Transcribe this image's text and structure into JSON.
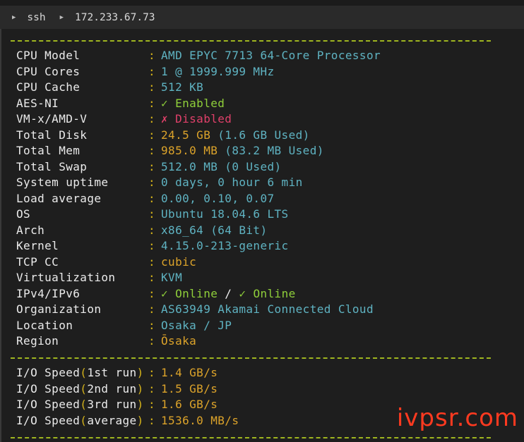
{
  "tab": {
    "breadcrumb": [
      "ssh",
      "172.233.67.73"
    ]
  },
  "system_info": [
    {
      "label": "CPU Model",
      "value": [
        {
          "t": "AMD EPYC 7713 64-Core Processor",
          "c": "cyan"
        }
      ]
    },
    {
      "label": "CPU Cores",
      "value": [
        {
          "t": "1 @ 1999.999 MHz",
          "c": "cyan"
        }
      ]
    },
    {
      "label": "CPU Cache",
      "value": [
        {
          "t": "512 KB",
          "c": "cyan"
        }
      ]
    },
    {
      "label": "AES-NI",
      "value": [
        {
          "t": "✓ Enabled",
          "c": "green"
        }
      ]
    },
    {
      "label": "VM-x/AMD-V",
      "value": [
        {
          "t": "✗ ",
          "c": "red"
        },
        {
          "t": "Disabled",
          "c": "red"
        }
      ]
    },
    {
      "label": "Total Disk",
      "value": [
        {
          "t": "24.5 GB",
          "c": "yellow"
        },
        {
          "t": " (1.6 GB Used)",
          "c": "cyan"
        }
      ]
    },
    {
      "label": "Total Mem",
      "value": [
        {
          "t": "985.0 MB",
          "c": "yellow"
        },
        {
          "t": " (83.2 MB Used)",
          "c": "cyan"
        }
      ]
    },
    {
      "label": "Total Swap",
      "value": [
        {
          "t": "512.0 MB (0 Used)",
          "c": "cyan"
        }
      ]
    },
    {
      "label": "System uptime",
      "value": [
        {
          "t": "0 days, 0 hour 6 min",
          "c": "cyan"
        }
      ]
    },
    {
      "label": "Load average",
      "value": [
        {
          "t": "0.00, 0.10, 0.07",
          "c": "cyan"
        }
      ]
    },
    {
      "label": "OS",
      "value": [
        {
          "t": "Ubuntu 18.04.6 LTS",
          "c": "cyan"
        }
      ]
    },
    {
      "label": "Arch",
      "value": [
        {
          "t": "x86_64 (64 Bit)",
          "c": "cyan"
        }
      ]
    },
    {
      "label": "Kernel",
      "value": [
        {
          "t": "4.15.0-213-generic",
          "c": "cyan"
        }
      ]
    },
    {
      "label": "TCP CC",
      "value": [
        {
          "t": "cubic",
          "c": "yellow"
        }
      ]
    },
    {
      "label": "Virtualization",
      "value": [
        {
          "t": "KVM",
          "c": "cyan"
        }
      ]
    },
    {
      "label": "IPv4/IPv6",
      "value": [
        {
          "t": "✓ Online",
          "c": "green"
        },
        {
          "t": " / ",
          "c": "white"
        },
        {
          "t": "✓ Online",
          "c": "green"
        }
      ]
    },
    {
      "label": "Organization",
      "value": [
        {
          "t": "AS63949 Akamai Connected Cloud",
          "c": "cyan"
        }
      ]
    },
    {
      "label": "Location",
      "value": [
        {
          "t": "Osaka / JP",
          "c": "cyan"
        }
      ]
    },
    {
      "label": "Region",
      "value": [
        {
          "t": "Ōsaka",
          "c": "yellow"
        }
      ]
    }
  ],
  "io_speed": [
    {
      "prefix": "I/O Speed",
      "run": "1st run",
      "value": "1.4 GB/s"
    },
    {
      "prefix": "I/O Speed",
      "run": "2nd run",
      "value": "1.5 GB/s"
    },
    {
      "prefix": "I/O Speed",
      "run": "3rd run",
      "value": "1.6 GB/s"
    },
    {
      "prefix": "I/O Speed",
      "run": "average",
      "value": "1536.0 MB/s"
    }
  ],
  "separator": ":",
  "watermark": "ivpsr.com",
  "colors": {
    "background": "#1e1e1e",
    "cyan": "#5fb3c2",
    "yellow": "#dca32a",
    "green": "#8fcf3a",
    "red": "#e0406a",
    "dash": "#9fb51f",
    "watermark": "#ff3a20"
  }
}
